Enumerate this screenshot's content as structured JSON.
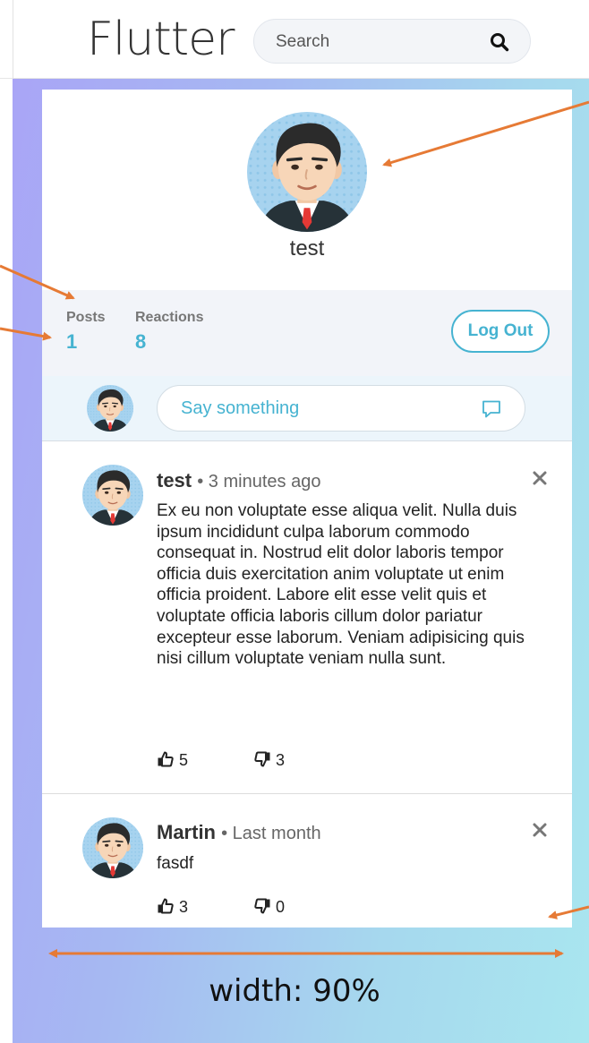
{
  "header": {
    "logo": "Flutter",
    "search_placeholder": "Search"
  },
  "profile": {
    "name": "test"
  },
  "stats": {
    "posts_label": "Posts",
    "posts_value": "1",
    "reactions_label": "Reactions",
    "reactions_value": "8",
    "logout_label": "Log Out"
  },
  "composer": {
    "placeholder": "Say something"
  },
  "posts": [
    {
      "author": "test",
      "time": "• 3 minutes ago",
      "body": "Ex eu non voluptate esse aliqua velit. Nulla duis ipsum incididunt culpa laborum commodo consequat in. Nostrud elit dolor laboris tempor officia duis exercitation anim voluptate ut enim officia proident. Labore elit esse velit quis et voluptate officia laboris cillum dolor pariatur excepteur esse laborum. Veniam adipisicing quis nisi cillum voluptate veniam nulla sunt.",
      "likes": "5",
      "dislikes": "3"
    },
    {
      "author": "Martin",
      "time": "• Last month",
      "body": "fasdf",
      "likes": "3",
      "dislikes": "0"
    }
  ],
  "annotation": {
    "width_label": "width: 90%"
  },
  "colors": {
    "accent": "#46b3d1",
    "arrow": "#e67a35",
    "stats_bg": "#f2f4f9",
    "composer_bg": "#ecf5fb"
  }
}
